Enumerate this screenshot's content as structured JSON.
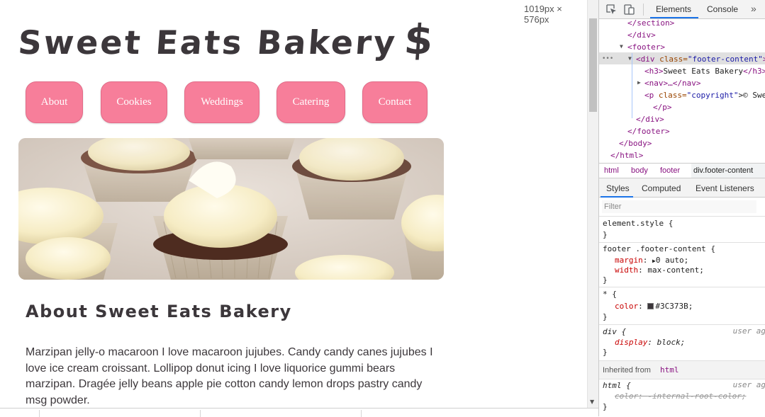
{
  "page": {
    "site_title": "Sweet Eats Bakery",
    "title_icon": "$",
    "nav_items": [
      "About",
      "Cookies",
      "Weddings",
      "Catering",
      "Contact"
    ],
    "hero_image": "cupcakes-icon",
    "about_heading": "About Sweet Eats Bakery",
    "about_text": "Marzipan jelly-o macaroon I love macaroon jujubes. Candy candy canes jujubes I love ice cream croissant. Lollipop donut icing I love liquorice gummi bears marzipan. Dragée jelly beans apple pie cotton candy lemon drops pastry candy msg powder.",
    "viewport_size": "1019px × 576px"
  },
  "colors": {
    "nav_button": "#f77e9a",
    "text": "#3C373B",
    "devtools_accent": "#1a73e8"
  },
  "devtools": {
    "tabs": {
      "elements": "Elements",
      "console": "Console"
    },
    "dom": {
      "section_close": "</section>",
      "div_close": "</div>",
      "footer_open": "<footer>",
      "div_tag": "<div ",
      "div_attr": "class=",
      "div_val": "\"footer-content\"",
      "div_end": ">",
      "h3_open": "<h3>",
      "h3_text": "Sweet Eats Bakery",
      "h3_close": "</h3>",
      "nav_line": "<nav>…</nav>",
      "p_tag": "<p ",
      "p_attr": "class=",
      "p_val": "\"copyright\"",
      "p_text": ">© Swe",
      "p_close": "</p>",
      "div_close2": "</div>",
      "footer_close": "</footer>",
      "body_close": "</body>",
      "html_close": "</html>",
      "ellipsis": "•••"
    },
    "breadcrumb": [
      "html",
      "body",
      "footer",
      "div.footer-content"
    ],
    "style_tabs": [
      "Styles",
      "Computed",
      "Event Listeners"
    ],
    "filter_placeholder": "Filter",
    "rules": {
      "element_style": "element.style {",
      "close": "}",
      "footer_selector": "footer .footer-content {",
      "margin_prop": "margin",
      "margin_val": "0 auto;",
      "width_prop": "width",
      "width_val": "max-content;",
      "star_selector": "* {",
      "color_prop": "color",
      "color_val": "#3C373B;",
      "div_selector": "div {",
      "user_agent": "user ag",
      "display_prop": "display",
      "display_val": "block;",
      "inherited_label": "Inherited from",
      "inherited_tag": "html",
      "html_selector": "html {",
      "html_color_prop": "color",
      "html_color_val": "-internal-root-color;"
    }
  }
}
